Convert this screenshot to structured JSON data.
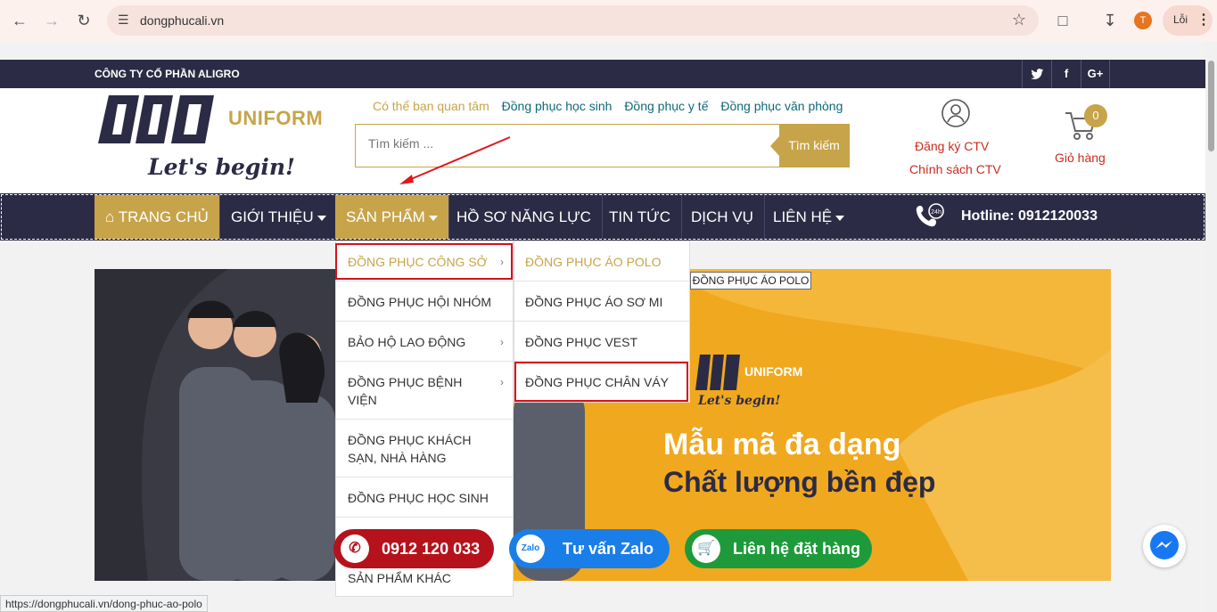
{
  "browser": {
    "url": "dongphucali.vn",
    "avatar_letter": "T",
    "error_label": "Lỗi"
  },
  "top_strip": {
    "company": "CÔNG TY CỔ PHẦN ALIGRO",
    "social": [
      "twitter-icon",
      "facebook-icon",
      "google-plus-icon"
    ]
  },
  "logo": {
    "brand": "ALI",
    "uniform": "UNIFORM",
    "slogan": "Let's begin!"
  },
  "interest": {
    "lead": "Có thể bạn quan tâm",
    "tags": [
      "Đồng phục học sinh",
      "Đồng phục y tế",
      "Đồng phục văn phòng"
    ]
  },
  "search": {
    "placeholder": "Tìm kiếm ...",
    "button": "Tìm kiếm"
  },
  "account": {
    "register": "Đăng ký CTV",
    "policy": "Chính sách CTV"
  },
  "cart": {
    "count": "0",
    "label": "Giỏ hàng"
  },
  "nav": {
    "home": "TRANG CHỦ",
    "about": "GIỚI THIỆU",
    "products": "SẢN PHẨM",
    "profile": "HỒ SƠ NĂNG LỰC",
    "news": "TIN TỨC",
    "services": "DỊCH VỤ",
    "contact": "LIÊN HỆ",
    "hotline": "Hotline: 0912120033"
  },
  "dropdown": {
    "items": [
      "ĐỒNG PHỤC CÔNG SỞ",
      "ĐỒNG PHỤC HỘI NHÓM",
      "BẢO HỘ LAO ĐỘNG",
      "ĐỒNG PHỤC BỆNH VIỆN",
      "ĐỒNG PHỤC KHÁCH SẠN, NHÀ HÀNG",
      "ĐỒNG PHỤC HỌC SINH",
      "SẢN PHẨM KHÁC"
    ]
  },
  "submenu": {
    "items": [
      "ĐỒNG PHỤC ÁO POLO",
      "ĐỒNG PHỤC ÁO SƠ MI",
      "ĐỒNG PHỤC VEST",
      "ĐỒNG PHỤC CHÂN VÁY"
    ]
  },
  "tooltip": "ĐỒNG PHỤC ÁO POLO",
  "banner": {
    "brand": "ALI",
    "uniform": "UNIFORM",
    "slogan": "Let's begin!",
    "headline1": "Mẫu mã đa dạng",
    "headline2": "Chất lượng bền đẹp"
  },
  "floating": {
    "phone": "0912 120 033",
    "zalo": "Tư vấn Zalo",
    "order": "Liên hệ đặt hàng"
  },
  "status_url": "https://dongphucali.vn/dong-phuc-ao-polo",
  "colors": {
    "navy": "#2c2b45",
    "gold": "#c7a449",
    "red": "#cc2b1d",
    "banner_orange": "#f0a81e"
  }
}
